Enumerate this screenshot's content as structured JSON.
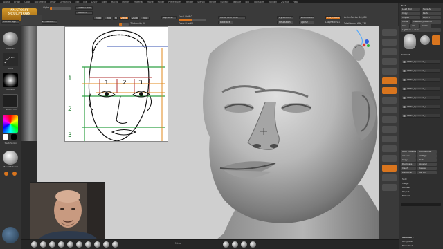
{
  "menubar": {
    "items": [
      "Alpha",
      "Brush",
      "Color",
      "Document",
      "Draw",
      "Dynamics",
      "Edit",
      "File",
      "Layer",
      "Light",
      "Macro",
      "Marker",
      "Material",
      "Movie",
      "Picker",
      "Preferences",
      "Render",
      "Stencil",
      "Stroke",
      "Surface",
      "Texture",
      "Tool",
      "Transform",
      "Zplugin",
      "Zscript",
      "Help"
    ]
  },
  "logo": {
    "line1": "ANATOMY",
    "line2": "SCULPTORS"
  },
  "toolbar": {
    "home_page": "Home Page",
    "lightbox": "LightBox",
    "live_boolean": "Live Boolean",
    "mrgb": "Mrgb",
    "rgb": "Rgb",
    "m": "M",
    "zadd": "Zadd",
    "zsub": "Zsub",
    "zcut": "Zcut",
    "rgb_intensity": "Rgb Intensity",
    "z_intensity": "Z Intensity 29",
    "z_intensity_value": 0.29,
    "focal_shift": "Focal Shift 0",
    "draw_size": "Draw Size 64",
    "dynamic": "Dynamic",
    "active_points": "ActivePoints: 46,804",
    "total_points": "TotalPoints: 636,131",
    "mirror_weld": "Mirror And Weld",
    "lazymouse": "LazyMouse",
    "lazyradius": "LazyRadius 1",
    "backface": "Backface",
    "zremesher": "ZRemesher",
    "xpose": "Xpose",
    "dynamesh": "DynaMesh",
    "resolution": "Resolution",
    "adjust": "Adjust",
    "switch_color": "Switch Color",
    "gradient": "Gradient"
  },
  "right_panel": {
    "tool_header": "Tool",
    "load_tool": "Load Tool",
    "save_as": "Save As",
    "copy_tool": "Copy",
    "paste_tool": "Paste",
    "import": "Import",
    "export": "Export",
    "clone": "Clone",
    "make_polymesh": "Make PolyMesh3D",
    "goz": "GoZ",
    "all": "All",
    "visible": "Visible",
    "lightbox_tools": "Lightbox > Tools",
    "subtool_header": "Subtool",
    "subtools": [
      "PM3D_Sphere3D_1",
      "PM3D_Sphere3D_2",
      "PM3D_Sphere3D_3",
      "PM3D_Sphere3D_4",
      "PM3D_Sphere3D_5",
      "PM3D_Sphere3D_6",
      "PM3D_Sphere3D_7"
    ],
    "options": [
      "Auto Collapse",
      "AutoReorder",
      "All Low",
      "All High",
      "Copy",
      "Paste",
      "Duplicate",
      "Append",
      "Insert",
      "Delete",
      "Del Other",
      "Del All",
      "Split",
      "Merge",
      "Remesh",
      "Project",
      "Extract"
    ],
    "geometry": "Geometry",
    "arraymesh": "ArrayMesh",
    "nanomesh": "NanoMesh"
  },
  "left_shelf": {
    "labels": [
      "Standard",
      "Dots",
      "Alpha Off",
      "Texture Off",
      "BasicMaterial",
      "Gradient",
      "SwitchColor",
      "Alternate"
    ]
  },
  "bottom_bar": {
    "mirror_label": "Mirror"
  },
  "reference": {
    "row_labels": [
      "1",
      "2",
      "3"
    ],
    "column_labels": [
      "1",
      "2",
      "3"
    ]
  },
  "colors": {
    "accent": "#d9751e",
    "panel": "#2f2f2f",
    "viewport": "#cfcfcf",
    "guide_green": "#2ea043",
    "guide_orange": "#e08a1e",
    "guide_red": "#b03030",
    "guide_blue": "#3550b0"
  }
}
